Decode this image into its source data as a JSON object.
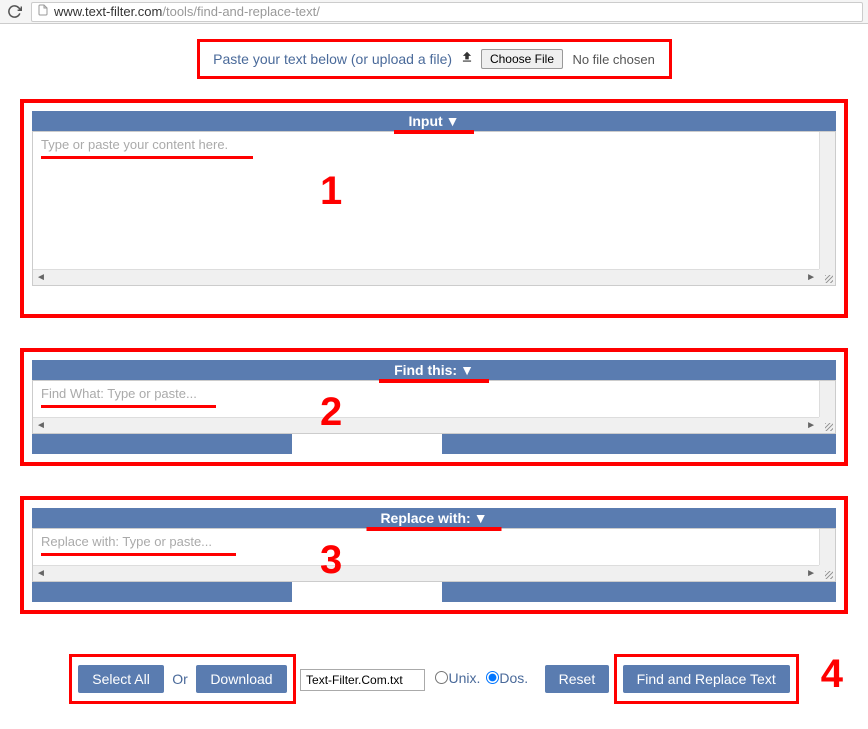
{
  "url": {
    "domain": "www.text-filter.com",
    "path": "/tools/find-and-replace-text/"
  },
  "instruction": {
    "prefix": "Paste your text below (or upload a file)",
    "choose_btn": "Choose File",
    "file_status": "No file chosen"
  },
  "sections": {
    "input": {
      "header": "Input",
      "placeholder": "Type or paste your content here."
    },
    "find": {
      "header": "Find this:",
      "placeholder": "Find What: Type or paste..."
    },
    "replace": {
      "header": "Replace with:",
      "placeholder": "Replace with: Type or paste..."
    }
  },
  "steps": {
    "one": "1",
    "two": "2",
    "three": "3",
    "four": "4"
  },
  "controls": {
    "select_all": "Select All",
    "or": "Or",
    "download": "Download",
    "filename": "Text-Filter.Com.txt",
    "unix_label": "Unix.",
    "dos_label": "Dos.",
    "reset": "Reset",
    "replace_btn": "Find and Replace Text"
  }
}
